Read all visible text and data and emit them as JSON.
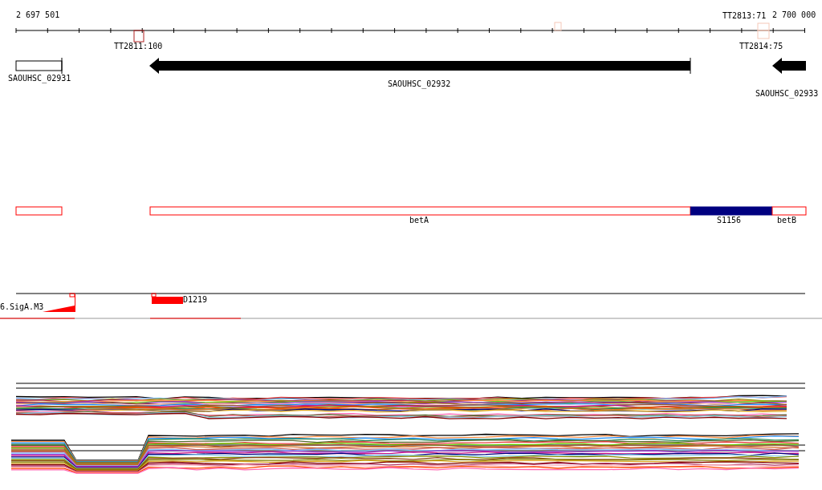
{
  "ruler": {
    "start_label": "2 697 501",
    "end_label": "2 700 000"
  },
  "terminators": [
    {
      "label": "TT2811:100",
      "strong": true
    },
    {
      "strong": false
    },
    {
      "label": "TT2813:71",
      "strong": false
    },
    {
      "label": "TT2814:75",
      "strong": false
    }
  ],
  "genes": [
    {
      "label": "SAOUHSC_02931",
      "kind": "box"
    },
    {
      "label": "SAOUHSC_02932",
      "kind": "arrow"
    },
    {
      "label": "SAOUHSC_02933",
      "kind": "arrow"
    }
  ],
  "annotations": [
    {
      "kind": "outline"
    },
    {
      "label": "betA",
      "kind": "outline"
    },
    {
      "label": "S1156",
      "kind": "filled"
    },
    {
      "label": "betB",
      "kind": "outline"
    }
  ],
  "sites": [
    {
      "label": "6.SigA.M3",
      "kind": "promoter"
    },
    {
      "label": "D1219",
      "kind": "bar"
    }
  ]
}
